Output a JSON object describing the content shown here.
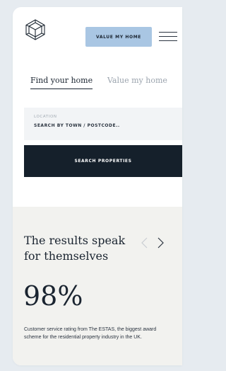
{
  "header": {
    "logo_icon": "geometric-hexagon-logo",
    "value_button_label": "VALUE MY HOME",
    "menu_icon": "hamburger-menu"
  },
  "tabs": [
    {
      "label": "Find your home",
      "active": true
    },
    {
      "label": "Value my home",
      "active": false
    }
  ],
  "search": {
    "location_label": "LOCATION",
    "location_placeholder": "SEARCH BY TOWN / POSTCODE..",
    "button_label": "SEARCH PROPERTIES"
  },
  "results": {
    "heading": "The results speak for themselves",
    "stat": "98%",
    "description": "Customer service rating from The ESTAS, the biggest award scheme for the residential property industry in the UK.",
    "prev_icon": "chevron-left",
    "next_icon": "chevron-right"
  },
  "colors": {
    "background": "#e6ebf0",
    "accent_button": "#a9c6e3",
    "dark_button": "#15202b",
    "results_bg": "#f2f2ef",
    "text": "#1a2430"
  }
}
